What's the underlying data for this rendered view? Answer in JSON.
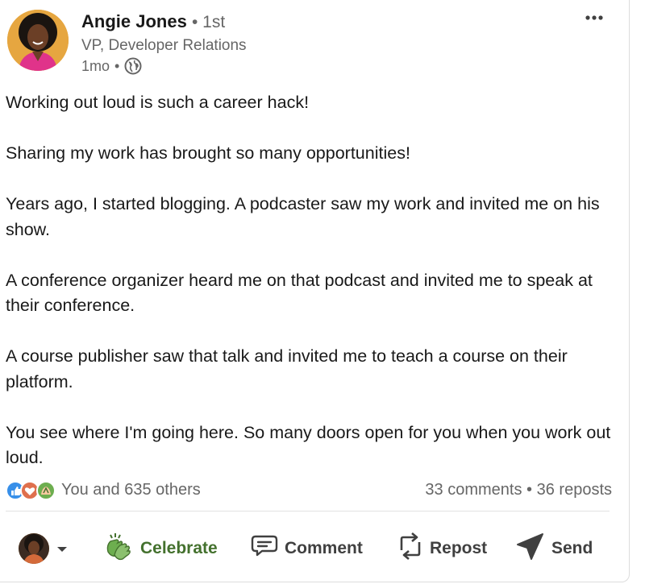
{
  "author": {
    "name": "Angie Jones",
    "separator": "•",
    "degree": "1st",
    "headline": "VP, Developer Relations",
    "time": "1mo",
    "time_separator": "•",
    "visibility_icon": "globe-icon"
  },
  "post": {
    "paragraphs": [
      "Working out loud is such a career hack!",
      "Sharing my work has brought so many opportunities!",
      "Years ago, I started blogging. A podcaster saw my work and invited me on his show.",
      "A conference organizer heard me on that podcast and invited me to speak at their conference.",
      "A course publisher saw that talk and invited me to teach a course on their platform.",
      "You see where I'm going here. So many doors open for you when you work out loud."
    ]
  },
  "social": {
    "reactions_text": "You and 635 others",
    "comments": "33 comments",
    "dot": "•",
    "reposts": "36 reposts",
    "reaction_icons": [
      "like-icon",
      "love-icon",
      "celebrate-icon"
    ]
  },
  "actions": {
    "celebrate": "Celebrate",
    "comment": "Comment",
    "repost": "Repost",
    "send": "Send"
  },
  "colors": {
    "celebrate_green": "#44712e",
    "text_primary": "#191919",
    "text_secondary": "#666666"
  }
}
